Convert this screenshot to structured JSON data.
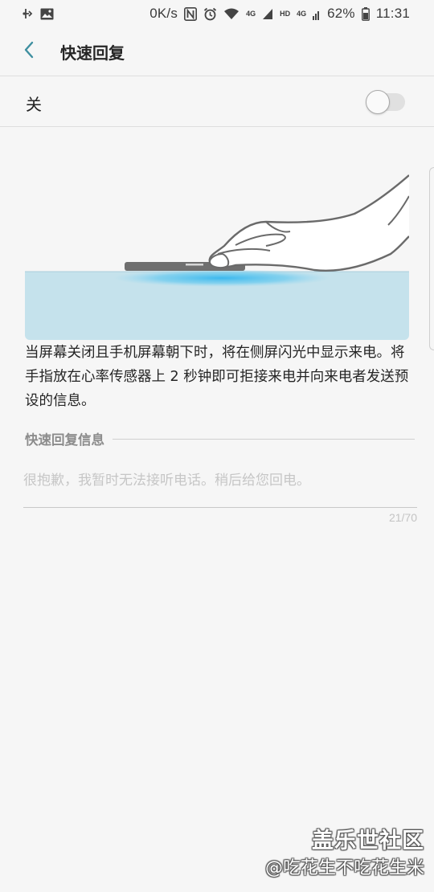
{
  "status_bar": {
    "speed": "0K/s",
    "net_tag_1": "4G",
    "hd_tag": "HD",
    "net_tag_2": "4G",
    "battery": "62%",
    "time": "11:31",
    "icons": [
      "call-forward-icon",
      "image-icon",
      "nfc-icon",
      "alarm-icon",
      "wifi-icon",
      "signal-icon",
      "battery-icon"
    ]
  },
  "header": {
    "back_icon": "chevron-left-icon",
    "title": "快速回复"
  },
  "switch": {
    "label": "关",
    "state": "off"
  },
  "description": "当屏幕关闭且手机屏幕朝下时，将在侧屏闪光中显示来电。将手指放在心率传感器上 2 秒钟即可拒接来电并向来电者发送预设的信息。",
  "reply_section": {
    "title": "快速回复信息",
    "placeholder": "很抱歉，我暂时无法接听电话。稍后给您回电。",
    "counter": "21/70"
  },
  "watermark": {
    "logo": "盖乐世社区",
    "user": "@吃花生不吃花生米"
  },
  "colors": {
    "background": "#f6f6f6",
    "accent": "#3e8fa0",
    "surface_blue": "#c5e2ec",
    "glow_blue": "#4fc2ef"
  }
}
